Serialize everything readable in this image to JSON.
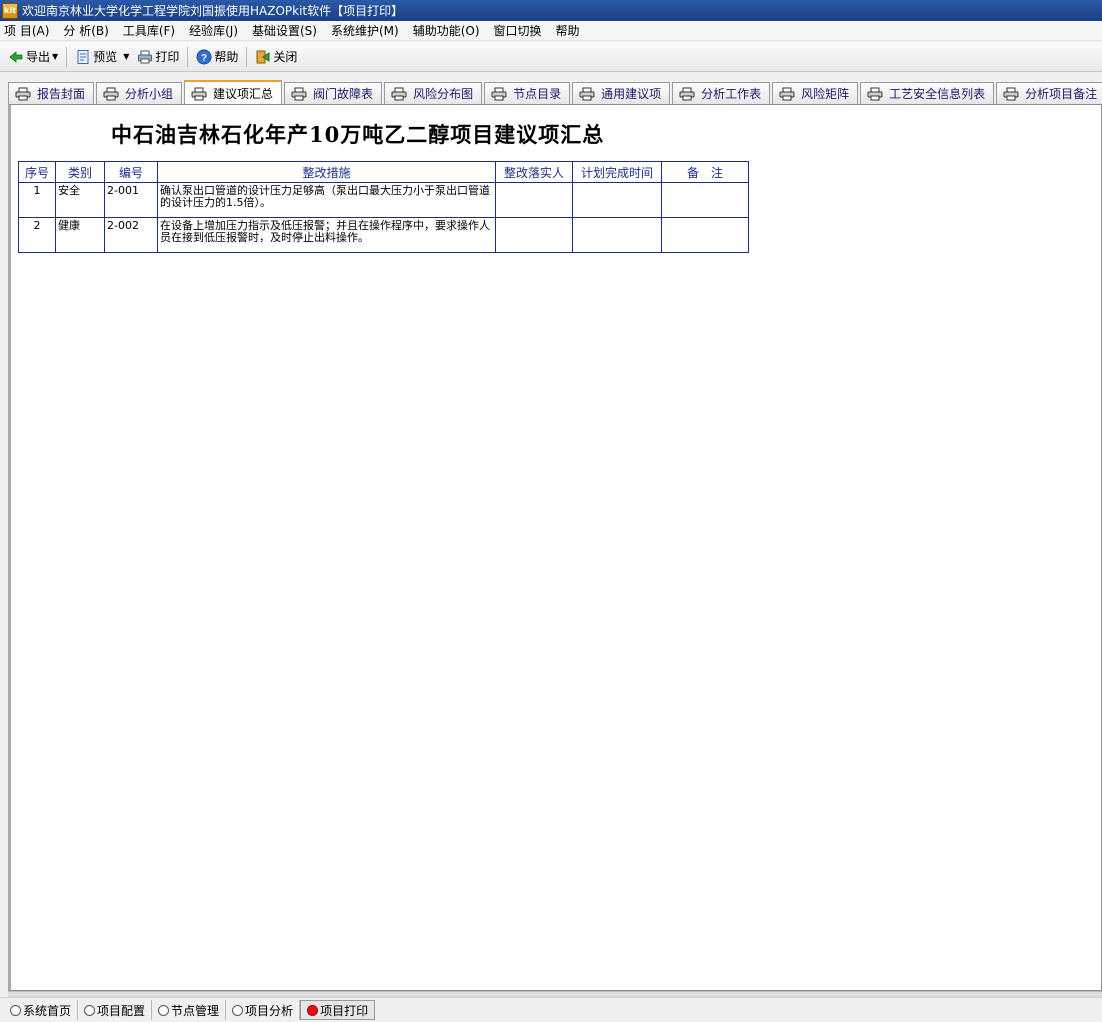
{
  "window": {
    "title": "欢迎南京林业大学化学工程学院刘国振使用HAZOPkit软件【项目打印】",
    "icon_text": "kit"
  },
  "menu": [
    "项 目(A)",
    "分 析(B)",
    "工具库(F)",
    "经验库(J)",
    "基础设置(S)",
    "系统维护(M)",
    "辅助功能(O)",
    "窗口切换",
    "帮助"
  ],
  "toolbar": {
    "export": "导出",
    "preview": "预览",
    "print": "打印",
    "help": "帮助",
    "close": "关闭"
  },
  "tabs": [
    "报告封面",
    "分析小组",
    "建议项汇总",
    "阀门故障表",
    "风险分布图",
    "节点目录",
    "通用建议项",
    "分析工作表",
    "风险矩阵",
    "工艺安全信息列表",
    "分析项目备注"
  ],
  "active_tab": "建议项汇总",
  "report": {
    "title": "中石油吉林石化年产10万吨乙二醇项目建议项汇总",
    "columns": [
      "序号",
      "类别",
      "编号",
      "整改措施",
      "整改落实人",
      "计划完成时间",
      "备　注"
    ],
    "rows": [
      {
        "seq": "1",
        "category": "安全",
        "code": "2-001",
        "measure": "确认泵出口管道的设计压力足够高（泵出口最大压力小于泵出口管道的设计压力的1.5倍）。",
        "owner": "",
        "due": "",
        "remark": ""
      },
      {
        "seq": "2",
        "category": "健康",
        "code": "2-002",
        "measure": "在设备上增加压力指示及低压报警；并且在操作程序中，要求操作人员在接到低压报警时，及时停止出料操作。",
        "owner": "",
        "due": "",
        "remark": ""
      }
    ]
  },
  "status": [
    {
      "label": "系统首页",
      "active": false
    },
    {
      "label": "项目配置",
      "active": false
    },
    {
      "label": "节点管理",
      "active": false
    },
    {
      "label": "项目分析",
      "active": false
    },
    {
      "label": "项目打印",
      "active": true
    }
  ],
  "colors": {
    "title_bar": "#1a3f86",
    "table_border": "#1b2f8a",
    "active_tab_accent": "#f0a030",
    "active_status_dot": "#e81010"
  }
}
